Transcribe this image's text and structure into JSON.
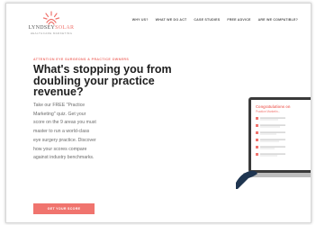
{
  "header": {
    "logo": {
      "name_part1": "LYNDSEY",
      "name_part2": "SOLAR",
      "tagline": "HEALTHCARE MARKETING"
    },
    "nav": [
      "WHY US?",
      "WHAT WE DO ACT",
      "CASE STUDIES",
      "FREE ADVICE",
      "ARE WE COMPATIBLE?"
    ]
  },
  "hero": {
    "eyebrow": "ATTENTION EYE SURGEONS & PRACTICE OWNERS",
    "headline": "What's stopping you from doubling your practice revenue?",
    "body": "Take our FREE \"Practice Marketing\" quiz. Get your score on the 9 areas you must master to run a world-class eye surgery practice. Discover how your scores compare against industry benchmarks.",
    "cta_label": "GET YOUR SCORE"
  },
  "laptop_screen": {
    "title": "Congratulations on",
    "subtitle": "Practice Marketin..."
  },
  "colors": {
    "accent": "#f0746e",
    "headline": "#1e1e1e",
    "body": "#6b6b6b"
  }
}
